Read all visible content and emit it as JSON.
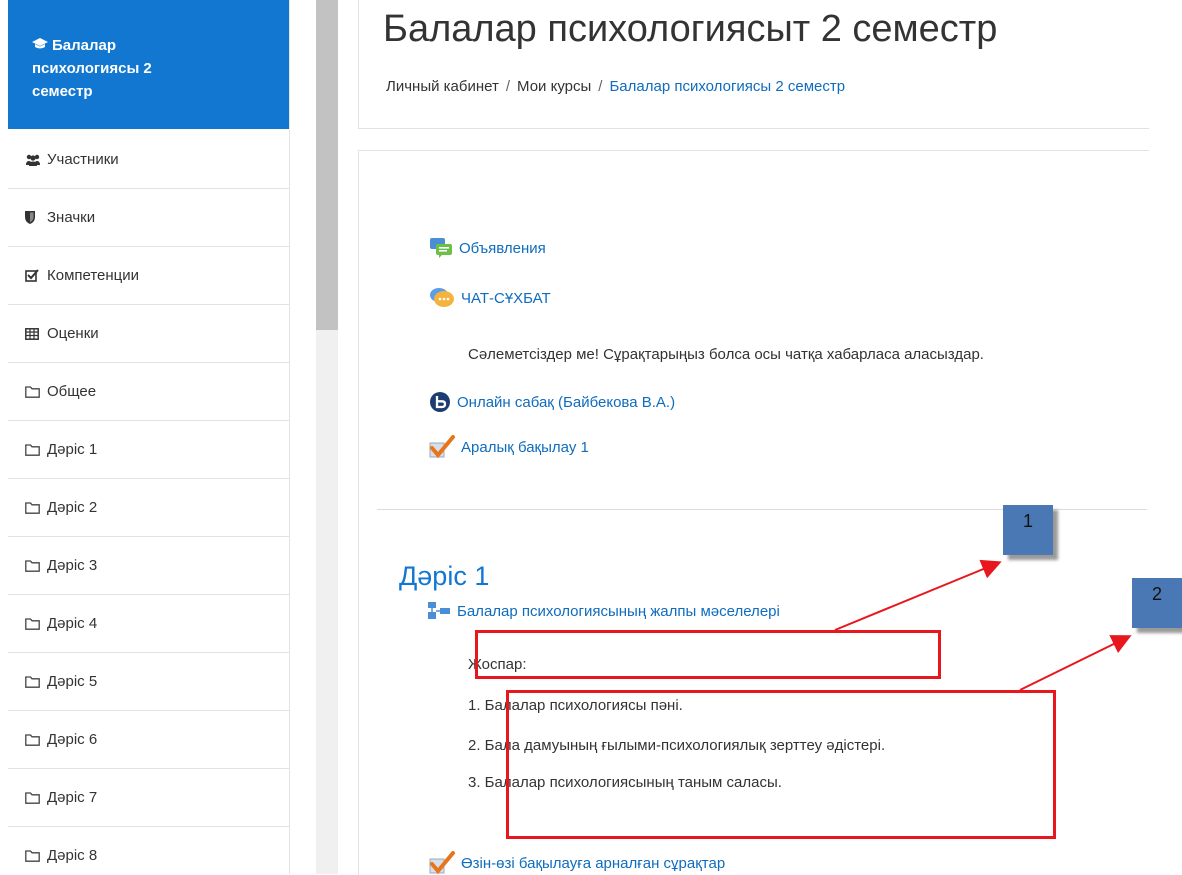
{
  "sidebar": {
    "active": {
      "label_line1": "Балалар",
      "label_line2": "психологиясы 2",
      "label_line3": "семестр",
      "icon": "graduation-cap-icon"
    },
    "items": [
      {
        "label": "Участники",
        "icon": "users-icon"
      },
      {
        "label": "Значки",
        "icon": "shield-icon"
      },
      {
        "label": "Компетенции",
        "icon": "checkbox-icon"
      },
      {
        "label": "Оценки",
        "icon": "table-icon"
      },
      {
        "label": "Общее",
        "icon": "folder-icon"
      },
      {
        "label": "Дәріс 1",
        "icon": "folder-icon"
      },
      {
        "label": "Дәріс 2",
        "icon": "folder-icon"
      },
      {
        "label": "Дәріс 3",
        "icon": "folder-icon"
      },
      {
        "label": "Дәріс 4",
        "icon": "folder-icon"
      },
      {
        "label": "Дәріс 5",
        "icon": "folder-icon"
      },
      {
        "label": "Дәріс 6",
        "icon": "folder-icon"
      },
      {
        "label": "Дәріс 7",
        "icon": "folder-icon"
      },
      {
        "label": "Дәріс 8",
        "icon": "folder-icon"
      }
    ]
  },
  "header": {
    "title": "Балалар психологиясыт 2 семестр",
    "breadcrumb": [
      "Личный кабинет",
      "Мои курсы",
      "Балалар психологиясы 2 семестр"
    ]
  },
  "content": {
    "announcements": "Объявления",
    "chat": "ЧАТ-СҰХБАТ",
    "chat_description": "Сәлеметсіздер ме! Сұрақтарыңыз болса осы чатқа хабарласа аласыздар.",
    "online_lesson": "Онлайн сабақ (Байбекова В.А.)",
    "midterm": "Аралық бақылау 1",
    "section_title": "Дәріс 1",
    "lecture_link": "Балалар психологиясының жалпы мәселелері",
    "plan_heading": "Жоспар:",
    "plan_items": [
      "1. Балалар психологиясы пәні.",
      "2. Бала дамуының ғылыми-психологиялық зерттеу әдістері.",
      "3. Балалар психологиясының таным саласы."
    ],
    "self_check": "Өзін-өзі бақылауға арналған сұрақтар"
  },
  "annotations": {
    "badge1": "1",
    "badge2": "2",
    "color": "#e8171d",
    "badge_color": "#4a78b4"
  },
  "colors": {
    "accent": "#1177d1",
    "link": "#0f6cbf"
  }
}
